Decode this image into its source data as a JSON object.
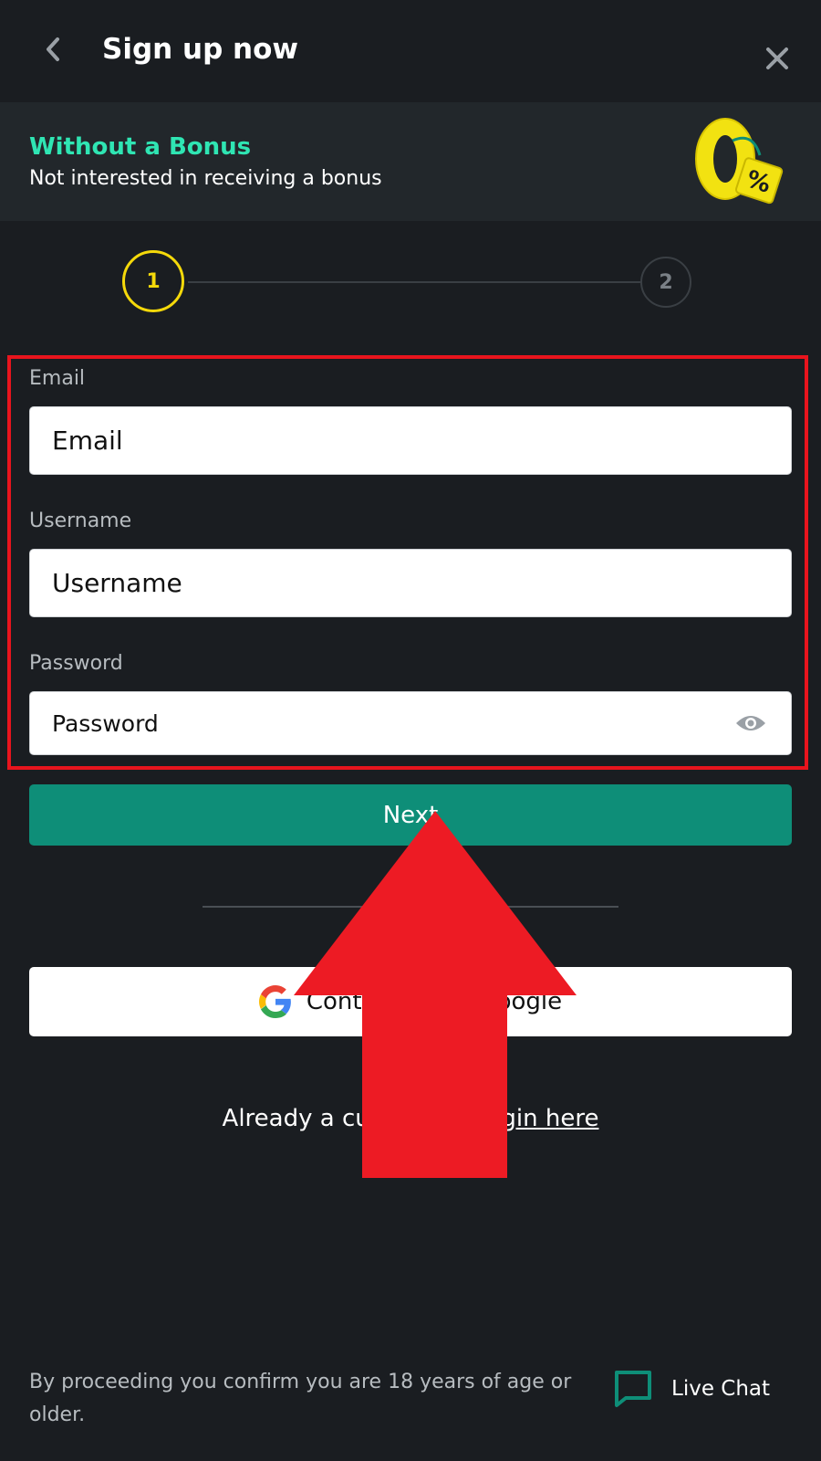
{
  "header": {
    "title": "Sign up now",
    "back_icon": "chevron-left-icon",
    "close_icon": "close-icon"
  },
  "banner": {
    "title": "Without a Bonus",
    "subtitle": "Not interested in receiving a bonus",
    "art_label": "0",
    "art_tag": "%"
  },
  "stepper": {
    "steps": [
      {
        "label": "1",
        "active": true
      },
      {
        "label": "2",
        "active": false
      }
    ]
  },
  "form": {
    "email_label": "Email",
    "email_placeholder": "Email",
    "username_label": "Username",
    "username_placeholder": "Username",
    "password_label": "Password",
    "password_placeholder": "Password"
  },
  "actions": {
    "next_label": "Next",
    "google_label": "Continue with Google"
  },
  "login": {
    "prompt": "Already a customer? ",
    "link": "Login here"
  },
  "footer": {
    "disclaimer": "By proceeding you confirm you are 18 years of age or older.",
    "live_chat_label": "Live Chat"
  },
  "colors": {
    "background": "#1a1d21",
    "banner_bg": "#22272b",
    "accent_teal": "#2fe5b3",
    "next_button": "#0e8e78",
    "step_active": "#f5d90a",
    "annotation_red": "#e8141d"
  }
}
